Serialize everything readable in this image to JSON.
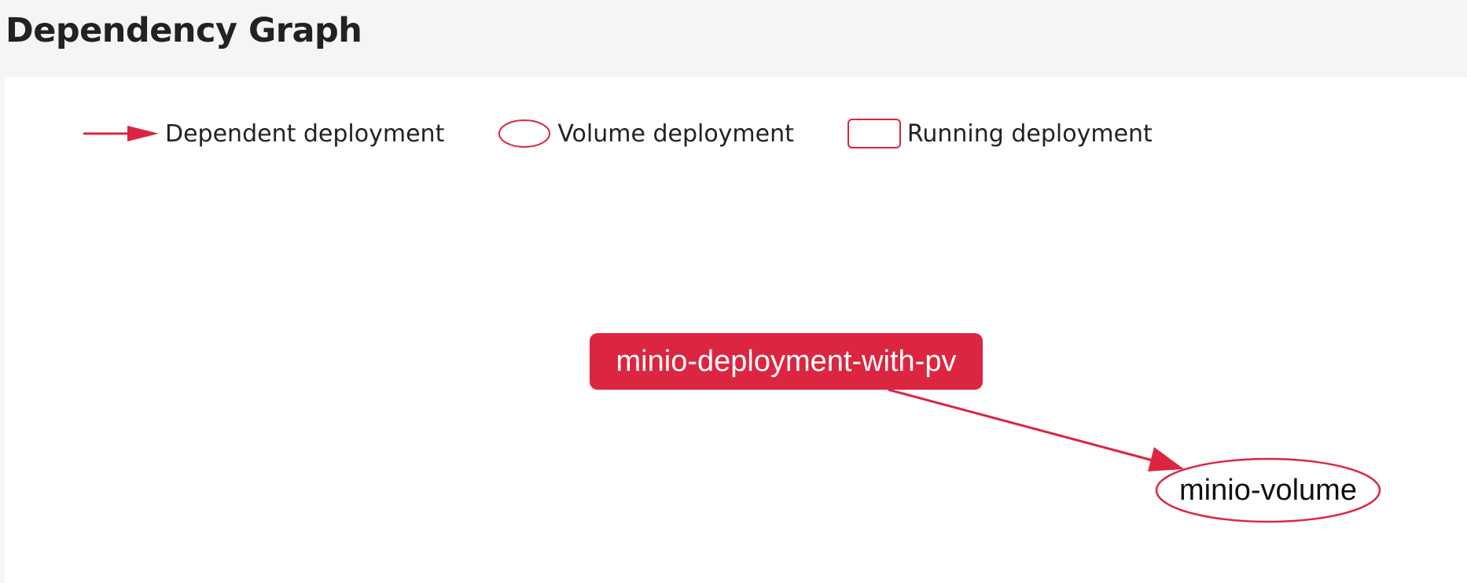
{
  "header": {
    "title": "Dependency Graph"
  },
  "legend": {
    "items": [
      {
        "kind": "edge",
        "label": "Dependent deployment"
      },
      {
        "kind": "volume",
        "label": "Volume deployment"
      },
      {
        "kind": "running",
        "label": "Running deployment"
      }
    ]
  },
  "graph": {
    "nodes": [
      {
        "id": "deployment",
        "label": "minio-deployment-with-pv",
        "kind": "running"
      },
      {
        "id": "volume",
        "label": "minio-volume",
        "kind": "volume"
      }
    ],
    "edges": [
      {
        "from": "deployment",
        "to": "volume"
      }
    ]
  },
  "colors": {
    "accent": "#dc2540",
    "node_text_on_accent": "#ffffff",
    "node_text": "#111111",
    "page_background": "#f5f5f5",
    "panel_background": "#ffffff"
  }
}
